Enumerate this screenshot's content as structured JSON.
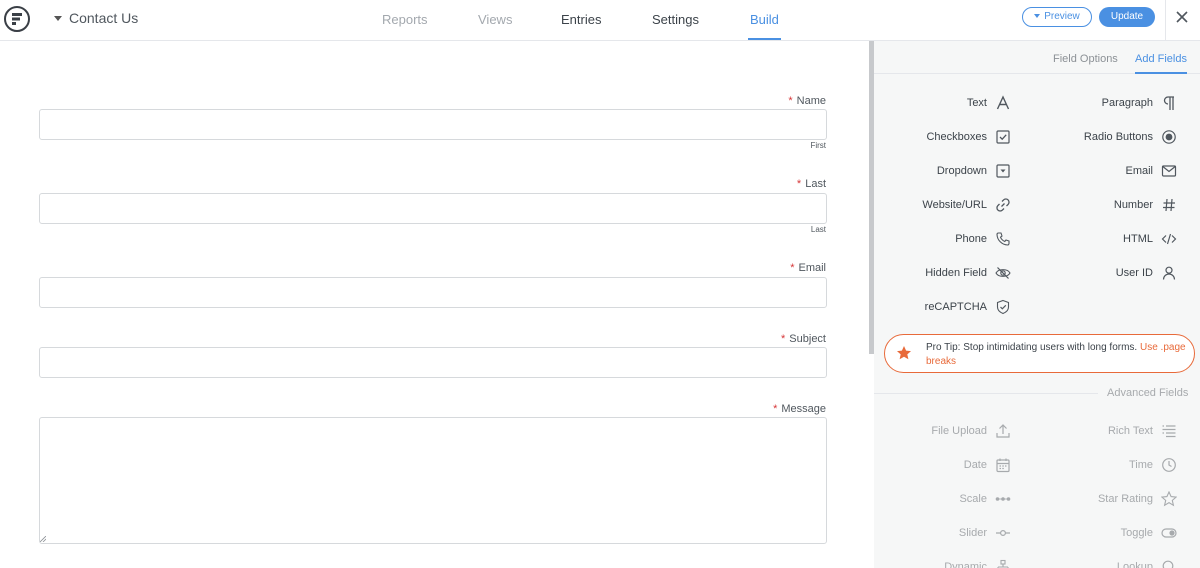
{
  "header": {
    "form_name": "Contact Us",
    "nav": [
      "Reports",
      "Views",
      "Entries",
      "Settings",
      "Build"
    ],
    "preview_label": "Preview",
    "update_label": "Update"
  },
  "form": {
    "fields": [
      {
        "label": "Name",
        "required": "*",
        "sublabel": "First"
      },
      {
        "label": "Last",
        "required": "*",
        "sublabel": "Last"
      },
      {
        "label": "Email",
        "required": "*"
      },
      {
        "label": "Subject",
        "required": "*"
      },
      {
        "label": "Message",
        "required": "*"
      }
    ]
  },
  "panel": {
    "tabs": [
      "Field Options",
      "Add Fields"
    ],
    "basic_fields": [
      {
        "label": "Text",
        "icon": "text-icon"
      },
      {
        "label": "Paragraph",
        "icon": "paragraph-icon"
      },
      {
        "label": "Checkboxes",
        "icon": "checkbox-icon"
      },
      {
        "label": "Radio Buttons",
        "icon": "radio-icon"
      },
      {
        "label": "Dropdown",
        "icon": "dropdown-icon"
      },
      {
        "label": "Email",
        "icon": "envelope-icon"
      },
      {
        "label": "Website/URL",
        "icon": "link-icon"
      },
      {
        "label": "Number",
        "icon": "hash-icon"
      },
      {
        "label": "Phone",
        "icon": "phone-icon"
      },
      {
        "label": "HTML",
        "icon": "code-icon"
      },
      {
        "label": "Hidden Field",
        "icon": "eye-slash-icon"
      },
      {
        "label": "User ID",
        "icon": "user-icon"
      },
      {
        "label": "reCAPTCHA",
        "icon": "shield-check-icon"
      }
    ],
    "protip": {
      "prefix": "Pro Tip:",
      "text": " Stop intimidating users with long forms. ",
      "link": "Use .page breaks"
    },
    "advanced_heading": "Advanced Fields",
    "advanced_fields": [
      {
        "label": "File Upload",
        "icon": "upload-icon"
      },
      {
        "label": "Rich Text",
        "icon": "rich-text-icon"
      },
      {
        "label": "Date",
        "icon": "calendar-icon"
      },
      {
        "label": "Time",
        "icon": "clock-icon"
      },
      {
        "label": "Scale",
        "icon": "scale-icon"
      },
      {
        "label": "Star Rating",
        "icon": "star-outline-icon"
      },
      {
        "label": "Slider",
        "icon": "slider-icon"
      },
      {
        "label": "Toggle",
        "icon": "toggle-icon"
      },
      {
        "label": "Dynamic",
        "icon": "sitemap-icon"
      },
      {
        "label": "Lookup",
        "icon": "search-icon"
      }
    ]
  },
  "colors": {
    "accent": "#4a90e2",
    "required": "#d63638",
    "protip": "#e86a3a"
  }
}
